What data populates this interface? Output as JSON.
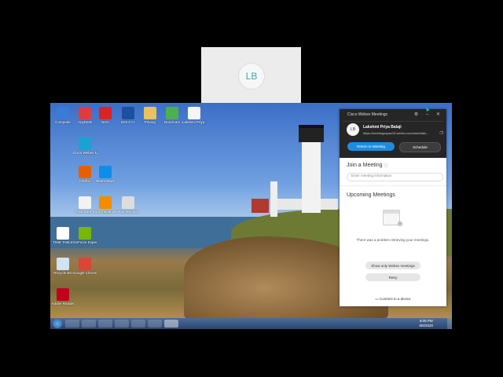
{
  "participant": {
    "initials": "LB"
  },
  "desktop": {
    "icons": [
      {
        "label": "Computer",
        "color": "#3a7bd5"
      },
      {
        "label": "AnyDesk",
        "color": "#e23b3b"
      },
      {
        "label": "Nero",
        "color": "#d22"
      },
      {
        "label": "Dev-C++",
        "color": "#1b4fa0"
      },
      {
        "label": "Privacy",
        "color": "#e8c25a"
      },
      {
        "label": "DroidCam",
        "color": "#4caf50"
      },
      {
        "label": "Lakshmi Priya Balaji",
        "color": "#f5f5f5"
      },
      {
        "label": "Cisco Webex Meetings",
        "color": "#1aa3d1"
      },
      {
        "label": "Firefox",
        "color": "#e66000"
      },
      {
        "label": "TeamViewer",
        "color": "#0e8ee9"
      },
      {
        "label": "Free Cam 8",
        "color": "#f2f2f2"
      },
      {
        "label": "VLC media player",
        "color": "#f28c00"
      },
      {
        "label": "Run terminal",
        "color": "#ddd"
      },
      {
        "label": "TIME TABLE",
        "color": "#fff"
      },
      {
        "label": "GeForce Experience",
        "color": "#76b900"
      },
      {
        "label": "Recycle Bin",
        "color": "#cfe3f5"
      },
      {
        "label": "Google Chrome",
        "color": "#db4437"
      },
      {
        "label": "Adobe Reader",
        "color": "#c0001d"
      }
    ]
  },
  "taskbar": {
    "time": "9:06 PM",
    "date": "6/6/2020"
  },
  "webex": {
    "title": "Cisco Webex Meetings",
    "win_buttons": "⚙ – ✕",
    "user": {
      "initials": "LB",
      "name": "Lakshmi Priya Balaji",
      "url": "https://meetingsapac15.webex.com/meet/laki..."
    },
    "return_button": "Return to Meeting",
    "schedule_button": "Schedule",
    "join_title": "Join a Meeting",
    "join_help": "ⓘ",
    "join_placeholder": "Enter meeting information",
    "upcoming_title": "Upcoming Meetings",
    "error_text": "There was a problem retrieving your meetings.",
    "show_only_button": "Show only Webex meetings",
    "retry_button": "Retry",
    "footer": "Connect to a device"
  }
}
